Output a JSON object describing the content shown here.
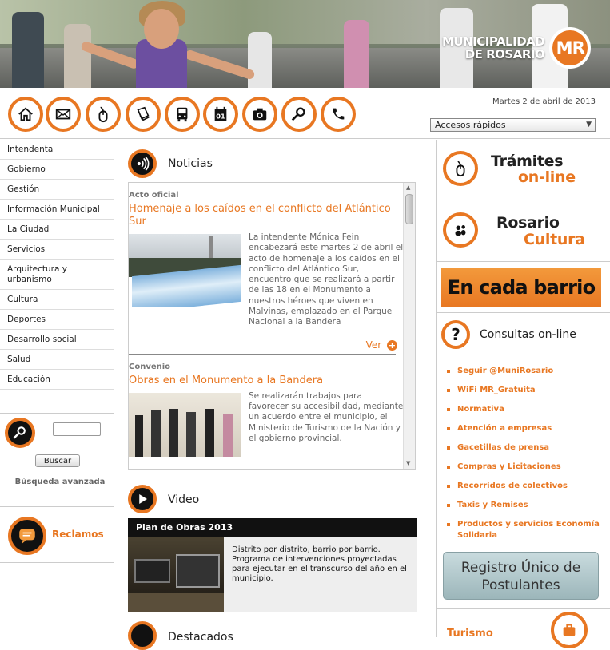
{
  "header": {
    "logo_line1": "MUNICIPALIDAD",
    "logo_line2": "DE ROSARIO",
    "logo_mark": "MR",
    "date": "Martes 2 de abril de 2013",
    "quick_access": "Accesos rápidos"
  },
  "toolbar": {
    "icons": [
      "home-icon",
      "mail-icon",
      "mouse-icon",
      "document-icon",
      "bus-icon",
      "calendar-icon",
      "camera-icon",
      "search-icon",
      "phone-icon"
    ],
    "calendar_day": "01"
  },
  "sidebar": {
    "items": [
      {
        "label": "Intendenta"
      },
      {
        "label": "Gobierno"
      },
      {
        "label": "Gestión"
      },
      {
        "label": "Información Municipal"
      },
      {
        "label": "La Ciudad"
      },
      {
        "label": "Servicios"
      },
      {
        "label": "Arquitectura y urbanismo"
      },
      {
        "label": "Cultura"
      },
      {
        "label": "Deportes"
      },
      {
        "label": "Desarrollo social"
      },
      {
        "label": "Salud"
      },
      {
        "label": "Educación"
      }
    ],
    "search_button": "Buscar",
    "advanced_search": "Búsqueda avanzada",
    "reclamos": "Reclamos"
  },
  "news": {
    "title": "Noticias",
    "items": [
      {
        "category": "Acto oficial",
        "headline": "Homenaje a los caídos en el conflicto del Atlántico Sur",
        "text": "La intendente Mónica Fein encabezará este martes 2 de abril el acto de homenaje a los caídos en el conflicto del Atlántico Sur, encuentro que se realizará a partir de las 18 en el Monumento a nuestros héroes que viven en Malvinas, emplazado en el Parque Nacional a la Bandera",
        "more": "Ver"
      },
      {
        "category": "Convenio",
        "headline": "Obras en el Monumento a la Bandera",
        "text": "Se realizarán trabajos para favorecer su accesibilidad, mediante un acuerdo entre el municipio, el Ministerio de Turismo de la Nación y el gobierno provincial."
      }
    ]
  },
  "video": {
    "title": "Video",
    "clip_title": "Plan de Obras 2013",
    "description": "Distrito por distrito, barrio por barrio. Programa de intervenciones proyectadas para ejecutar en el transcurso del año en el municipio."
  },
  "destacados": {
    "title": "Destacados"
  },
  "right": {
    "tramites_1": "Trámites",
    "tramites_2": "on-line",
    "cultura_1": "Rosario",
    "cultura_2": "Cultura",
    "barrio": "En cada barrio",
    "consultas": "Consultas on-line",
    "links": [
      "Seguir @MuniRosario",
      "WiFi MR_Gratuita",
      "Normativa",
      "Atención a empresas",
      "Gacetillas de prensa",
      "Compras y Licitaciones",
      "Recorridos de colectivos",
      "Taxis y Remises",
      "Productos y servicios Economía Solidaria"
    ],
    "registro": "Registro Único de Postulantes",
    "turismo": "Turismo"
  },
  "colors": {
    "accent": "#e87722",
    "dark": "#111111"
  }
}
